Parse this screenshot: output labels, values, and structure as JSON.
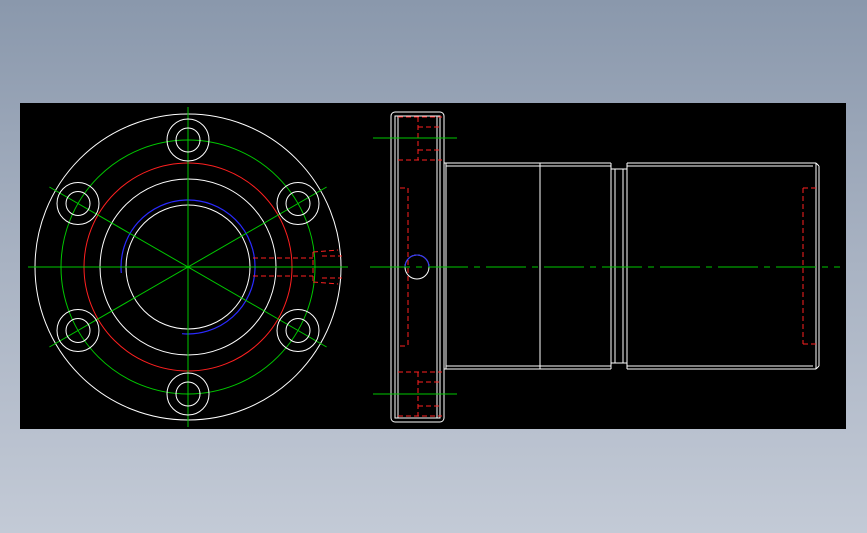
{
  "viewport": {
    "background": "#000000"
  },
  "colors": {
    "outline": "#ffffff",
    "centerline": "#00c800",
    "hidden": "#ff2020",
    "pitch_red": "#ff2020",
    "pitch_blue": "#2a2aff"
  },
  "views": [
    {
      "name": "front-view",
      "features": [
        "flange-outline",
        "bolt-circle",
        "six-bolt-holes",
        "bore",
        "red-circle",
        "blue-arc",
        "radial-hidden-hole"
      ]
    },
    {
      "name": "side-view",
      "features": [
        "flange-section",
        "nut-body",
        "groove",
        "axis-centerline",
        "hidden-holes",
        "side-hole"
      ]
    }
  ]
}
